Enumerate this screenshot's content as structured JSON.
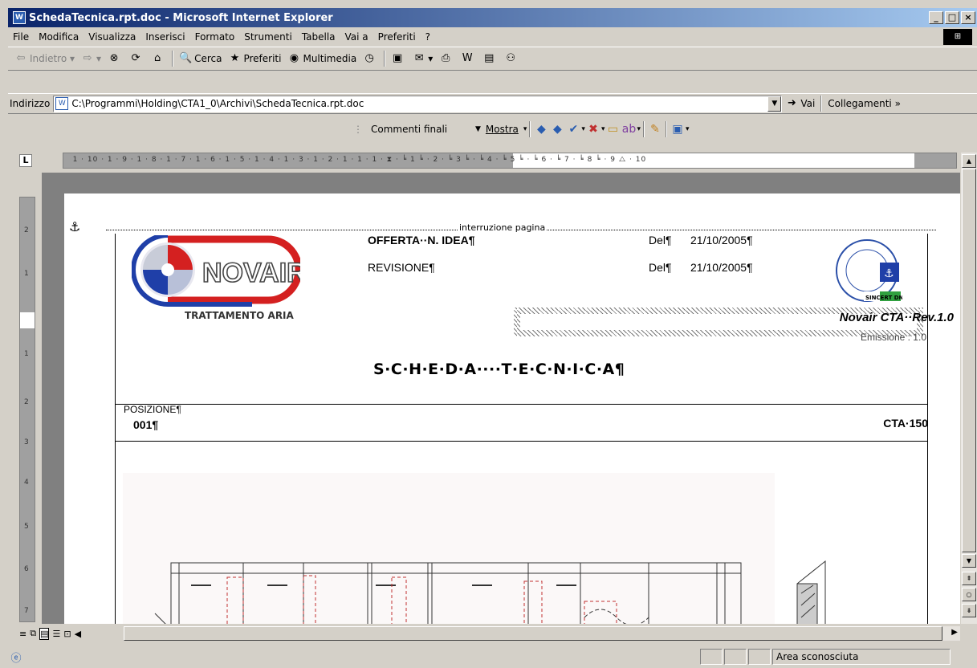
{
  "window": {
    "title": "SchedaTecnica.rpt.doc - Microsoft Internet Explorer"
  },
  "menu": [
    "File",
    "Modifica",
    "Visualizza",
    "Inserisci",
    "Formato",
    "Strumenti",
    "Tabella",
    "Vai a",
    "Preferiti",
    "?"
  ],
  "toolbar": {
    "back": "Indietro",
    "search": "Cerca",
    "favorites": "Preferiti",
    "media": "Multimedia"
  },
  "address": {
    "label": "Indirizzo",
    "value": "C:\\Programmi\\Holding\\CTA1_0\\Archivi\\SchedaTecnica.rpt.doc",
    "go": "Vai",
    "links": "Collegamenti"
  },
  "wordbar": {
    "markup_view": "Commenti finali",
    "show": "Mostra"
  },
  "document": {
    "page_break": "interruzione pagina",
    "logo_text": "NOVAIR",
    "logo_caption": "TRATTAMENTO ARIA",
    "offer_label": "OFFERTA··N. IDEA¶",
    "revision_label": "REVISIONE¶",
    "date_label_1": "Del¶",
    "date_1": "21/10/2005¶",
    "date_label_2": "Del¶",
    "date_2": "21/10/2005¶",
    "reference": "Novair CTA··Rev.1.0",
    "emission": "Emissione : 1.0",
    "cert_text": "SINCERT DNV",
    "title": "S·C·H·E·D·A····T·E·C·N·I·C·A¶",
    "position_label": "POSIZIONE¶",
    "position_value": "001¶",
    "model": "CTA·150"
  },
  "status": {
    "zone": "Area sconosciuta"
  },
  "colors": {
    "title_bar": "#0a246a",
    "logo_red": "#d42020",
    "logo_blue": "#1f3fa8",
    "face": "#d4d0c8"
  }
}
